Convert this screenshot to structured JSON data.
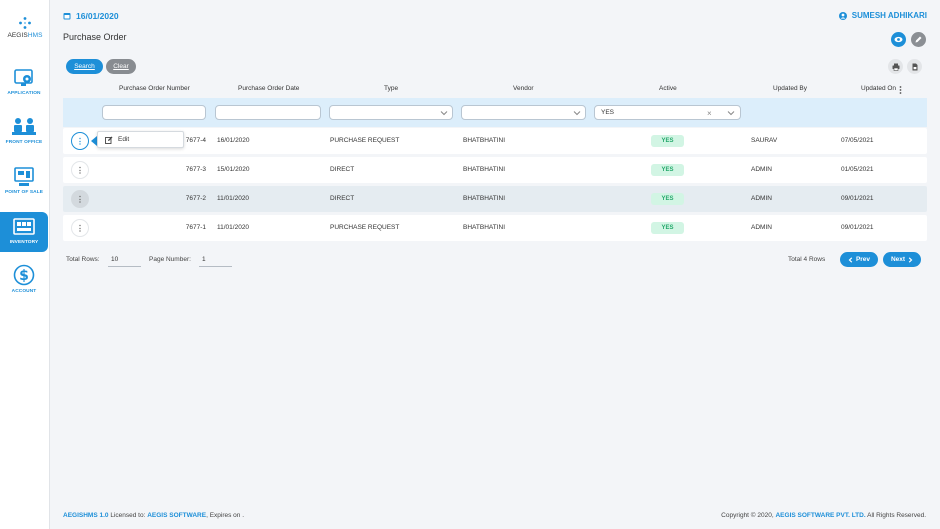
{
  "brand": {
    "logo_prefix": "AEGIS",
    "logo_suffix": "HMS"
  },
  "sidebar": {
    "items": [
      {
        "label": "APPLICATION",
        "icon": "settings-monitor-icon"
      },
      {
        "label": "FRONT OFFICE",
        "icon": "front-office-icon"
      },
      {
        "label": "POINT OF SALE",
        "icon": "pos-monitor-icon"
      },
      {
        "label": "INVENTORY",
        "icon": "inventory-store-icon",
        "active": true
      },
      {
        "label": "ACCOUNT",
        "icon": "account-money-icon"
      }
    ]
  },
  "header": {
    "date": "16/01/2020",
    "user": "SUMESH ADHIKARI",
    "page_title": "Purchase Order"
  },
  "toolbar": {
    "search_label": "Search",
    "clear_label": "Clear"
  },
  "table": {
    "columns": [
      "Purchase Order Number",
      "Purchase Order Date",
      "Type",
      "Vendor",
      "Active",
      "Updated By",
      "Updated On"
    ],
    "filters": {
      "active_value": "YES"
    },
    "rows": [
      {
        "number": "7677-4",
        "date": "16/01/2020",
        "type": "PURCHASE REQUEST",
        "vendor": "BHATBHATINI",
        "active": "YES",
        "updated_by": "SAURAV",
        "updated_on": "07/05/2021"
      },
      {
        "number": "7677-3",
        "date": "15/01/2020",
        "type": "DIRECT",
        "vendor": "BHATBHATINI",
        "active": "YES",
        "updated_by": "ADMIN",
        "updated_on": "01/05/2021"
      },
      {
        "number": "7677-2",
        "date": "11/01/2020",
        "type": "DIRECT",
        "vendor": "BHATBHATINI",
        "active": "YES",
        "updated_by": "ADMIN",
        "updated_on": "09/01/2021"
      },
      {
        "number": "7677-1",
        "date": "11/01/2020",
        "type": "PURCHASE REQUEST",
        "vendor": "BHATBHATINI",
        "active": "YES",
        "updated_by": "ADMIN",
        "updated_on": "09/01/2021"
      }
    ],
    "row_menu": {
      "edit_label": "Edit"
    }
  },
  "pager": {
    "total_rows_label": "Total Rows:",
    "total_rows_value": "10",
    "page_number_label": "Page Number:",
    "page_number_value": "1",
    "total_text": "Total 4 Rows",
    "prev_label": "Prev",
    "next_label": "Next"
  },
  "footer": {
    "product": "AEGISHMS 1.0",
    "licensed_to_label": "Licensed to:",
    "licensee": "AEGIS SOFTWARE",
    "expires_text": ", Expires on .",
    "copyright_prefix": "Copyright © 2020,",
    "company": "AEGIS SOFTWARE PVT. LTD.",
    "rights": "All Rights Reserved."
  },
  "colors": {
    "accent": "#1d8fd8",
    "success_bg": "#d2f5e4",
    "success_text": "#23a86a",
    "filter_bg": "#dceefb"
  }
}
